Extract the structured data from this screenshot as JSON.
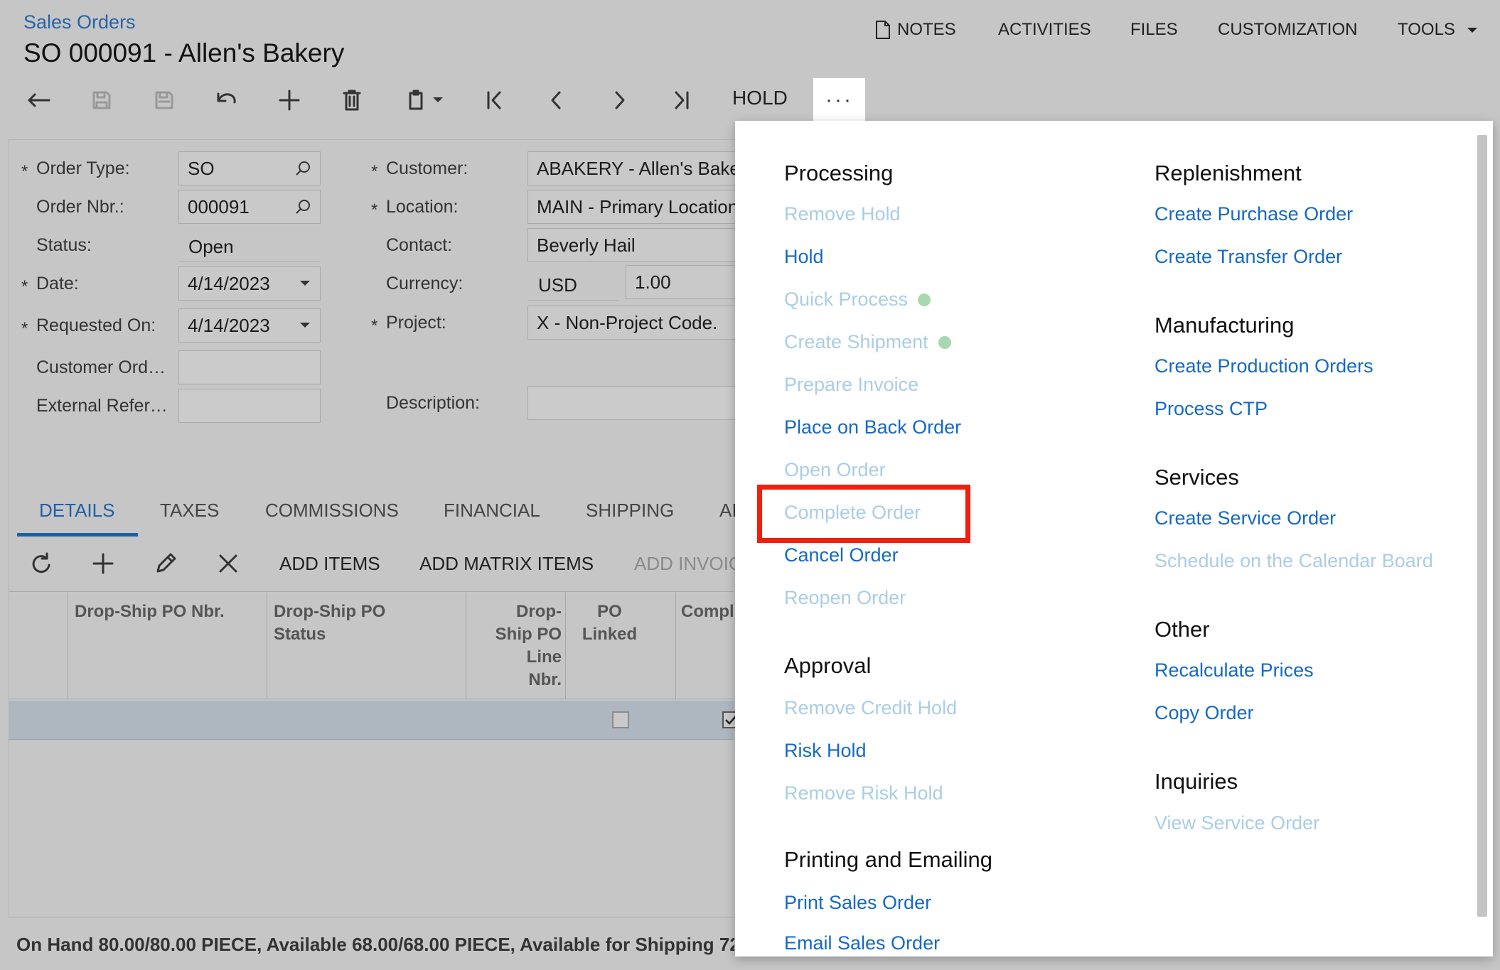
{
  "header": {
    "breadcrumb": "Sales Orders",
    "title": "SO 000091 - Allen's Bakery"
  },
  "topnav": {
    "notes": "NOTES",
    "activities": "ACTIVITIES",
    "files": "FILES",
    "customization": "CUSTOMIZATION",
    "tools": "TOOLS"
  },
  "toolbar": {
    "hold": "HOLD",
    "more": "···"
  },
  "form": {
    "order_type": {
      "label": "Order Type:",
      "value": "SO"
    },
    "order_nbr": {
      "label": "Order Nbr.:",
      "value": "000091"
    },
    "status": {
      "label": "Status:",
      "value": "Open"
    },
    "date": {
      "label": "Date:",
      "value": "4/14/2023"
    },
    "requested_on": {
      "label": "Requested On:",
      "value": "4/14/2023"
    },
    "customer_ord": {
      "label": "Customer Ord…",
      "value": ""
    },
    "external_ref": {
      "label": "External Refer…",
      "value": ""
    },
    "customer": {
      "label": "Customer:",
      "value": "ABAKERY - Allen's Bake"
    },
    "location": {
      "label": "Location:",
      "value": "MAIN - Primary Location"
    },
    "contact": {
      "label": "Contact:",
      "value": "Beverly Hail"
    },
    "currency": {
      "label": "Currency:",
      "value": "USD",
      "rate": "1.00"
    },
    "project": {
      "label": "Project:",
      "value": "X - Non-Project Code."
    },
    "description": {
      "label": "Description:",
      "value": ""
    },
    "required_mark": "*"
  },
  "tabs": [
    "DETAILS",
    "TAXES",
    "COMMISSIONS",
    "FINANCIAL",
    "SHIPPING",
    "AI"
  ],
  "grid_toolbar": {
    "add_items": "ADD ITEMS",
    "add_matrix_items": "ADD MATRIX ITEMS",
    "add_invoice": "ADD INVOIC"
  },
  "grid": {
    "columns": [
      "Drop-Ship PO Nbr.",
      "Drop-Ship PO Status",
      "Drop-Ship PO Line Nbr.",
      "PO Linked",
      "Compl"
    ],
    "row": {
      "po_linked": false,
      "completed": true
    }
  },
  "status_bar": "On Hand 80.00/80.00 PIECE, Available 68.00/68.00 PIECE, Available for Shipping 72",
  "menu": {
    "processing": {
      "title": "Processing",
      "items": [
        {
          "label": "Remove Hold",
          "enabled": false
        },
        {
          "label": "Hold",
          "enabled": true
        },
        {
          "label": "Quick Process",
          "enabled": false
        },
        {
          "label": "Create Shipment",
          "enabled": false
        },
        {
          "label": "Prepare Invoice",
          "enabled": false
        },
        {
          "label": "Place on Back Order",
          "enabled": true
        },
        {
          "label": "Open Order",
          "enabled": false
        },
        {
          "label": "Complete Order",
          "enabled": false
        },
        {
          "label": "Cancel Order",
          "enabled": true
        },
        {
          "label": "Reopen Order",
          "enabled": false
        }
      ]
    },
    "approval": {
      "title": "Approval",
      "items": [
        {
          "label": "Remove Credit Hold",
          "enabled": false
        },
        {
          "label": "Risk Hold",
          "enabled": true
        },
        {
          "label": "Remove Risk Hold",
          "enabled": false
        }
      ]
    },
    "printing": {
      "title": "Printing and Emailing",
      "items": [
        {
          "label": "Print Sales Order",
          "enabled": true
        },
        {
          "label": "Email Sales Order",
          "enabled": true
        }
      ]
    },
    "replenishment": {
      "title": "Replenishment",
      "items": [
        {
          "label": "Create Purchase Order",
          "enabled": true
        },
        {
          "label": "Create Transfer Order",
          "enabled": true
        }
      ]
    },
    "manufacturing": {
      "title": "Manufacturing",
      "items": [
        {
          "label": "Create Production Orders",
          "enabled": true
        },
        {
          "label": "Process CTP",
          "enabled": true
        }
      ]
    },
    "services": {
      "title": "Services",
      "items": [
        {
          "label": "Create Service Order",
          "enabled": true
        },
        {
          "label": "Schedule on the Calendar Board",
          "enabled": false
        }
      ]
    },
    "other": {
      "title": "Other",
      "items": [
        {
          "label": "Recalculate Prices",
          "enabled": true
        },
        {
          "label": "Copy Order",
          "enabled": true
        }
      ]
    },
    "inquiries": {
      "title": "Inquiries",
      "items": [
        {
          "label": "View Service Order",
          "enabled": false
        }
      ]
    }
  },
  "colors": {
    "link": "#1469c7",
    "link_disabled": "#aacde6",
    "highlight": "#f01f0e",
    "status_dot": "#a8d8ae"
  },
  "icons": [
    "back-icon",
    "save-close-icon",
    "save-icon",
    "undo-icon",
    "add-icon",
    "delete-icon",
    "copy-paste-icon",
    "first-icon",
    "previous-icon",
    "next-icon",
    "last-icon",
    "search-icon",
    "refresh-icon",
    "edit-icon",
    "close-icon",
    "notes-icon",
    "chevron-down-icon"
  ]
}
